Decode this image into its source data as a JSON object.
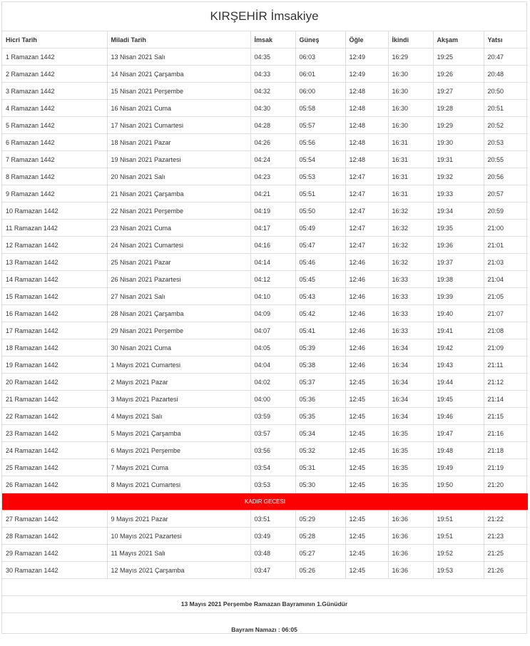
{
  "title": "KIRŞEHİR İmsakiye",
  "headers": [
    "Hicri Tarih",
    "Miladi Tarih",
    "İmsak",
    "Güneş",
    "Öğle",
    "İkindi",
    "Akşam",
    "Yatsı"
  ],
  "rows_before": [
    [
      "1 Ramazan 1442",
      "13 Nisan 2021 Salı",
      "04:35",
      "06:03",
      "12:49",
      "16:29",
      "19:25",
      "20:47"
    ],
    [
      "2 Ramazan 1442",
      "14 Nisan 2021 Çarşamba",
      "04:33",
      "06:01",
      "12:49",
      "16:30",
      "19:26",
      "20:48"
    ],
    [
      "3 Ramazan 1442",
      "15 Nisan 2021 Perşembe",
      "04:32",
      "06:00",
      "12:48",
      "16:30",
      "19:27",
      "20:50"
    ],
    [
      "4 Ramazan 1442",
      "16 Nisan 2021 Cuma",
      "04:30",
      "05:58",
      "12:48",
      "16:30",
      "19:28",
      "20:51"
    ],
    [
      "5 Ramazan 1442",
      "17 Nisan 2021 Cumartesi",
      "04:28",
      "05:57",
      "12:48",
      "16:30",
      "19:29",
      "20:52"
    ],
    [
      "6 Ramazan 1442",
      "18 Nisan 2021 Pazar",
      "04:26",
      "05:56",
      "12:48",
      "16:31",
      "19:30",
      "20:53"
    ],
    [
      "7 Ramazan 1442",
      "19 Nisan 2021 Pazartesi",
      "04:24",
      "05:54",
      "12:48",
      "16:31",
      "19:31",
      "20:55"
    ],
    [
      "8 Ramazan 1442",
      "20 Nisan 2021 Salı",
      "04:23",
      "05:53",
      "12:47",
      "16:31",
      "19:32",
      "20:56"
    ],
    [
      "9 Ramazan 1442",
      "21 Nisan 2021 Çarşamba",
      "04:21",
      "05:51",
      "12:47",
      "16:31",
      "19:33",
      "20:57"
    ],
    [
      "10 Ramazan 1442",
      "22 Nisan 2021 Perşembe",
      "04:19",
      "05:50",
      "12:47",
      "16:32",
      "19:34",
      "20:59"
    ],
    [
      "11 Ramazan 1442",
      "23 Nisan 2021 Cuma",
      "04:17",
      "05:49",
      "12:47",
      "16:32",
      "19:35",
      "21:00"
    ],
    [
      "12 Ramazan 1442",
      "24 Nisan 2021 Cumartesi",
      "04:16",
      "05:47",
      "12:47",
      "16:32",
      "19:36",
      "21:01"
    ],
    [
      "13 Ramazan 1442",
      "25 Nisan 2021 Pazar",
      "04:14",
      "05:46",
      "12:46",
      "16:32",
      "19:37",
      "21:03"
    ],
    [
      "14 Ramazan 1442",
      "26 Nisan 2021 Pazartesi",
      "04:12",
      "05:45",
      "12:46",
      "16:33",
      "19:38",
      "21:04"
    ],
    [
      "15 Ramazan 1442",
      "27 Nisan 2021 Salı",
      "04:10",
      "05:43",
      "12:46",
      "16:33",
      "19:39",
      "21:05"
    ],
    [
      "16 Ramazan 1442",
      "28 Nisan 2021 Çarşamba",
      "04:09",
      "05:42",
      "12:46",
      "16:33",
      "19:40",
      "21:07"
    ],
    [
      "17 Ramazan 1442",
      "29 Nisan 2021 Perşembe",
      "04:07",
      "05:41",
      "12:46",
      "16:33",
      "19:41",
      "21:08"
    ],
    [
      "18 Ramazan 1442",
      "30 Nisan 2021 Cuma",
      "04:05",
      "05:39",
      "12:46",
      "16:34",
      "19:42",
      "21:09"
    ],
    [
      "19 Ramazan 1442",
      "1 Mayıs 2021 Cumartesi",
      "04:04",
      "05:38",
      "12:46",
      "16:34",
      "19:43",
      "21:11"
    ],
    [
      "20 Ramazan 1442",
      "2 Mayıs 2021 Pazar",
      "04:02",
      "05:37",
      "12:45",
      "16:34",
      "19:44",
      "21:12"
    ],
    [
      "21 Ramazan 1442",
      "3 Mayıs 2021 Pazartesi",
      "04:00",
      "05:36",
      "12:45",
      "16:34",
      "19:45",
      "21:14"
    ],
    [
      "22 Ramazan 1442",
      "4 Mayıs 2021 Salı",
      "03:59",
      "05:35",
      "12:45",
      "16:34",
      "19:46",
      "21:15"
    ],
    [
      "23 Ramazan 1442",
      "5 Mayıs 2021 Çarşamba",
      "03:57",
      "05:34",
      "12:45",
      "16:35",
      "19:47",
      "21:16"
    ],
    [
      "24 Ramazan 1442",
      "6 Mayıs 2021 Perşembe",
      "03:56",
      "05:32",
      "12:45",
      "16:35",
      "19:48",
      "21:18"
    ],
    [
      "25 Ramazan 1442",
      "7 Mayıs 2021 Cuma",
      "03:54",
      "05:31",
      "12:45",
      "16:35",
      "19:49",
      "21:19"
    ],
    [
      "26 Ramazan 1442",
      "8 Mayıs 2021 Cumartesi",
      "03:53",
      "05:30",
      "12:45",
      "16:35",
      "19:50",
      "21:20"
    ]
  ],
  "kadir_label": "KADIR GECESI",
  "kadir_color": "#ff0000",
  "rows_after": [
    [
      "27 Ramazan 1442",
      "9 Mayıs 2021 Pazar",
      "03:51",
      "05:29",
      "12:45",
      "16:36",
      "19:51",
      "21:22"
    ],
    [
      "28 Ramazan 1442",
      "10 Mayıs 2021 Pazartesi",
      "03:49",
      "05:28",
      "12:45",
      "16:36",
      "19:51",
      "21:23"
    ],
    [
      "29 Ramazan 1442",
      "11 Mayıs 2021 Salı",
      "03:48",
      "05:27",
      "12:45",
      "16:36",
      "19:52",
      "21:25"
    ],
    [
      "30 Ramazan 1442",
      "12 Mayıs 2021 Çarşamba",
      "03:47",
      "05:26",
      "12:45",
      "16:36",
      "19:53",
      "21:26"
    ]
  ],
  "bayram_note": "13 Mayıs 2021 Perşembe Ramazan Bayramının 1.Günüdür",
  "bayram_namazi": "Bayram Namazı : 06:05"
}
